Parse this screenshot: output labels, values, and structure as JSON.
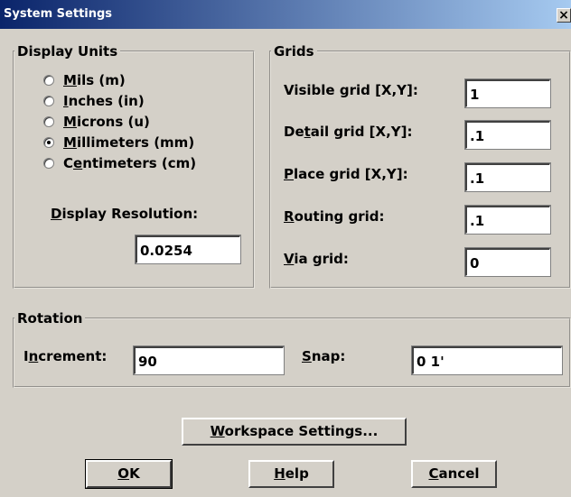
{
  "window": {
    "title": "System Settings",
    "close_glyph": "×"
  },
  "display_units": {
    "legend": "Display Units",
    "options": [
      {
        "pre": "",
        "key": "M",
        "post": "ils (m)",
        "selected": false
      },
      {
        "pre": "",
        "key": "I",
        "post": "nches (in)",
        "selected": false
      },
      {
        "pre": "",
        "key": "M",
        "post": "icrons (u)",
        "selected": false
      },
      {
        "pre": "",
        "key": "M",
        "post": "illimeters (mm)",
        "selected": true
      },
      {
        "pre": "C",
        "key": "e",
        "post": "ntimeters (cm)",
        "selected": false
      }
    ],
    "resolution_label_key": "D",
    "resolution_label_rest": "isplay Resolution:",
    "resolution_value": "0.0254"
  },
  "grids": {
    "legend": "Grids",
    "visible": {
      "pre": "Visible grid [X,Y]:",
      "value": "1"
    },
    "detail": {
      "pre": "De",
      "key": "t",
      "post": "ail grid [X,Y]:",
      "value": ".1"
    },
    "place": {
      "key": "P",
      "post": "lace grid [X,Y]:",
      "value": ".1"
    },
    "routing": {
      "key": "R",
      "post": "outing grid:",
      "value": ".1"
    },
    "via": {
      "key": "V",
      "post": "ia grid:",
      "value": "0"
    }
  },
  "rotation": {
    "legend": "Rotation",
    "increment": {
      "pre": "I",
      "key": "n",
      "post": "crement:",
      "value": "90"
    },
    "snap": {
      "key": "S",
      "post": "nap:",
      "value": "0 1'"
    }
  },
  "buttons": {
    "workspace": {
      "key": "W",
      "post": "orkspace Settings..."
    },
    "ok": {
      "key": "O",
      "post": "K"
    },
    "help": {
      "key": "H",
      "post": "elp"
    },
    "cancel": {
      "key": "C",
      "post": "ancel"
    }
  }
}
